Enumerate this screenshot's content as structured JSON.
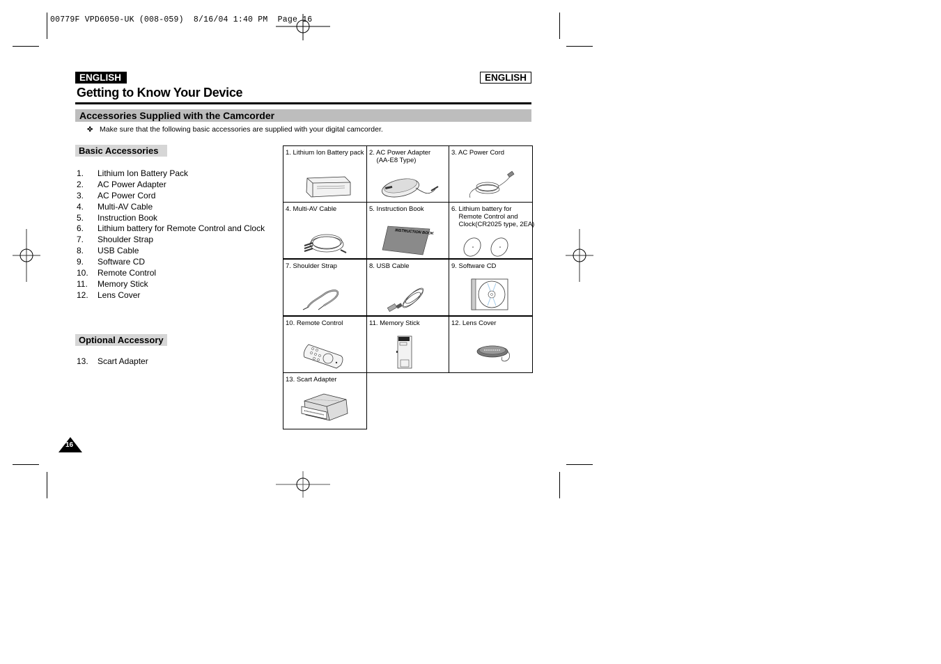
{
  "slug": {
    "text": "00779F VPD6050-UK (008-059)  8/16/04 1:40 PM  Page 16"
  },
  "header": {
    "language_left": "ENGLISH",
    "language_right": "ENGLISH",
    "title": "Getting to Know Your Device"
  },
  "section": {
    "title": "Accessories Supplied with the Camcorder",
    "note_bullet": "✤",
    "note": "Make sure that the following basic accessories are supplied with your digital camcorder."
  },
  "basic_accessories": {
    "heading": "Basic Accessories",
    "items": [
      {
        "num": "1.",
        "label": "Lithium Ion Battery Pack"
      },
      {
        "num": "2.",
        "label": "AC Power Adapter"
      },
      {
        "num": "3.",
        "label": "AC Power Cord"
      },
      {
        "num": "4.",
        "label": "Multi-AV Cable"
      },
      {
        "num": "5.",
        "label": "Instruction Book"
      },
      {
        "num": "6.",
        "label": "Lithium battery for Remote Control and Clock"
      },
      {
        "num": "7.",
        "label": "Shoulder Strap"
      },
      {
        "num": "8.",
        "label": "USB Cable"
      },
      {
        "num": "9.",
        "label": "Software CD"
      },
      {
        "num": "10.",
        "label": "Remote Control"
      },
      {
        "num": "11.",
        "label": "Memory Stick"
      },
      {
        "num": "12.",
        "label": "Lens Cover"
      }
    ]
  },
  "optional_accessory": {
    "heading": "Optional Accessory",
    "items": [
      {
        "num": "13.",
        "label": "Scart Adapter"
      }
    ]
  },
  "grid": {
    "cells": [
      {
        "label": "1. Lithium Ion Battery pack",
        "icon": "battery-pack-icon"
      },
      {
        "label": "2. AC Power Adapter\n    (AA-E8 Type)",
        "icon": "power-adapter-icon"
      },
      {
        "label": "3. AC Power Cord",
        "icon": "power-cord-icon"
      },
      {
        "label": "4. Multi-AV Cable",
        "icon": "av-cable-icon"
      },
      {
        "label": "5. Instruction Book",
        "icon": "instruction-book-icon",
        "book_text": "INSTRUCTION BOOK"
      },
      {
        "label": "6. Lithium battery for\n    Remote Control and\n    Clock(CR2025 type, 2EA)",
        "icon": "coin-battery-icon"
      },
      {
        "label": "7. Shoulder Strap",
        "icon": "shoulder-strap-icon"
      },
      {
        "label": "8. USB Cable",
        "icon": "usb-cable-icon"
      },
      {
        "label": "9. Software CD",
        "icon": "cd-icon"
      },
      {
        "label": "10. Remote Control",
        "icon": "remote-control-icon"
      },
      {
        "label": "11. Memory Stick",
        "icon": "memory-stick-icon"
      },
      {
        "label": "12. Lens Cover",
        "icon": "lens-cover-icon"
      },
      {
        "label": "13. Scart Adapter",
        "icon": "scart-adapter-icon"
      }
    ]
  },
  "footer": {
    "page_number": "16"
  }
}
